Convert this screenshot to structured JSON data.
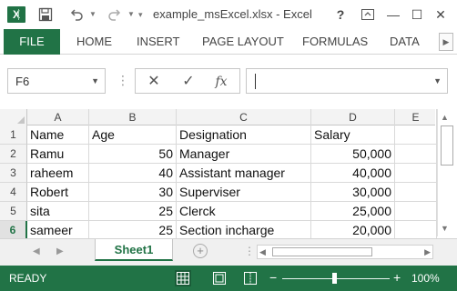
{
  "window": {
    "title": "example_msExcel.xlsx - Excel",
    "app_icon_letter": "X",
    "help": "?",
    "restore": "⧉",
    "minimize": "—",
    "maximize": "☐",
    "close": "✕"
  },
  "quick_access": {
    "save_icon": "save-icon",
    "undo_icon": "undo-icon",
    "redo_icon": "redo-icon",
    "customize_icon": "customize-dropdown-icon"
  },
  "ribbon": {
    "tabs": [
      "FILE",
      "HOME",
      "INSERT",
      "PAGE LAYOUT",
      "FORMULAS",
      "DATA"
    ],
    "active_color": "#217346"
  },
  "formula_bar": {
    "name_box": "F6",
    "formula": "",
    "cancel_symbol": "✕",
    "enter_symbol": "✓",
    "function_symbol": "fx"
  },
  "grid": {
    "columns": [
      "A",
      "B",
      "C",
      "D",
      "E"
    ],
    "rows": [
      {
        "num": "1",
        "cells": [
          "Name",
          "Age",
          "Designation",
          "Salary"
        ]
      },
      {
        "num": "2",
        "cells": [
          "Ramu",
          "50",
          "Manager",
          "50,000"
        ]
      },
      {
        "num": "3",
        "cells": [
          "raheem",
          "40",
          "Assistant manager",
          "40,000"
        ]
      },
      {
        "num": "4",
        "cells": [
          "Robert",
          "30",
          "Superviser",
          "30,000"
        ]
      },
      {
        "num": "5",
        "cells": [
          "sita",
          "25",
          "Clerck",
          "25,000"
        ]
      },
      {
        "num": "6",
        "cells": [
          "sameer",
          "25",
          "Section incharge",
          "20,000"
        ]
      }
    ],
    "selected_row": "6"
  },
  "sheets": {
    "tabs": [
      "Sheet1"
    ],
    "active": "Sheet1",
    "add_label": "+"
  },
  "status": {
    "text": "READY",
    "zoom": "100%",
    "zoom_minus": "−",
    "zoom_plus": "+",
    "bar_color": "#217346"
  }
}
